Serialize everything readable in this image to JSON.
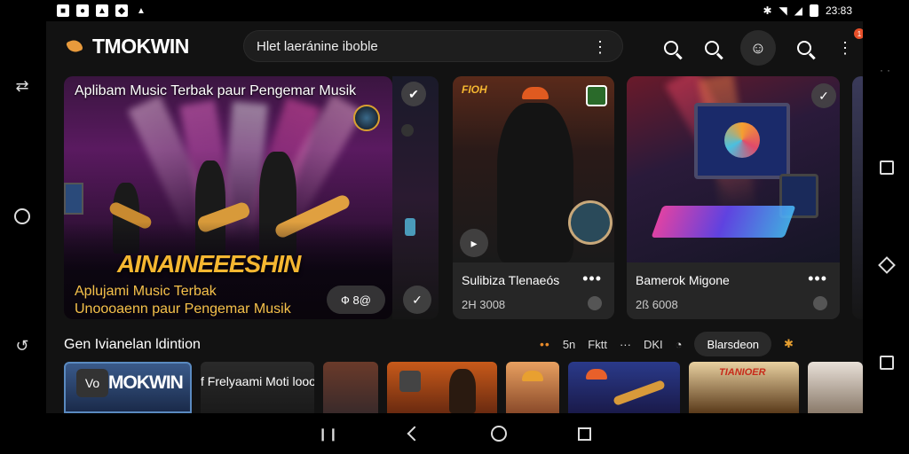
{
  "status_bar": {
    "icons_left": [
      "notification-icon-1",
      "notification-icon-2",
      "notification-icon-3",
      "notification-icon-4",
      "notification-icon-5"
    ],
    "time": "23:83"
  },
  "app": {
    "logo_text": "TMOKWIN",
    "search_text": "Hlet laeránine iboble",
    "notification_count": "1"
  },
  "hero_card": {
    "title": "Aplibam Music Terbak paur Pengemar Musik",
    "big_text": "AINAINEEESHIN",
    "subtitle_line1": "Aplujami Music Terbak",
    "subtitle_line2": "Unoooaenn paur Pengemar Musik",
    "pill_label": "Ф 8@",
    "accent": "#f5b731"
  },
  "cards": [
    {
      "title": "Sulibiza Tlenaeós",
      "number": "2H 3008",
      "badge": "FIOH"
    },
    {
      "title": "Bamerok Migone",
      "number": "2ß 6008"
    }
  ],
  "section": {
    "title": "Gen Ivianelan ldintion",
    "filters": [
      "5n",
      "Fktt",
      "DKI"
    ],
    "dropdown_label": "Blarsdeon"
  },
  "thumbnails": [
    {
      "label": "MOKWIN",
      "prefix": "Vo"
    },
    {
      "label": "f  Frelyaami Moti looohen"
    },
    {
      "label": ""
    },
    {
      "label": ""
    },
    {
      "label": ""
    },
    {
      "label": ""
    },
    {
      "label": "TIANIOER"
    },
    {
      "label": ""
    }
  ],
  "colors": {
    "background": "#121212",
    "card": "#262626",
    "accent_orange": "#e88a2a"
  }
}
